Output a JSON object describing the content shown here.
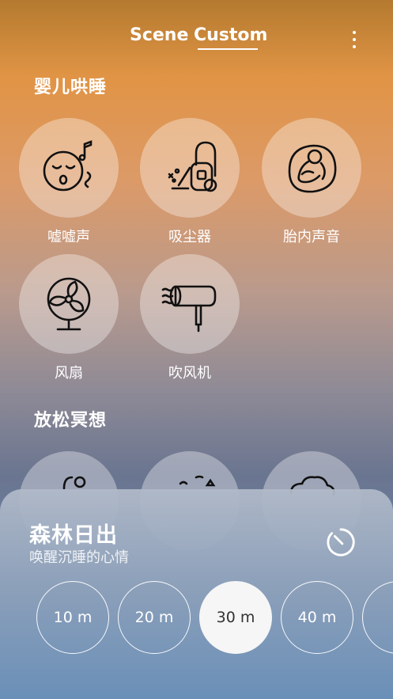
{
  "header": {
    "tabs": [
      {
        "label": "Scene"
      },
      {
        "label": "Custom",
        "selected": true
      }
    ],
    "menu_icon": "more-vertical-icon"
  },
  "sections": [
    {
      "title": "婴儿哄睡",
      "items": [
        {
          "label": "嘘嘘声",
          "icon": "sleeping-face-music-icon"
        },
        {
          "label": "吸尘器",
          "icon": "vacuum-cleaner-icon"
        },
        {
          "label": "胎内声音",
          "icon": "fetus-icon"
        },
        {
          "label": "风扇",
          "icon": "fan-icon"
        },
        {
          "label": "吹风机",
          "icon": "hair-dryer-icon"
        }
      ]
    },
    {
      "title": "放松冥想",
      "items": [
        {
          "label": "",
          "icon": "partial-icon-1"
        },
        {
          "label": "",
          "icon": "partial-icon-2"
        },
        {
          "label": "",
          "icon": "cloud-icon"
        }
      ]
    }
  ],
  "player": {
    "title": "森林日出",
    "subtitle": "唤醒沉睡的心情",
    "timer_icon": "timer-icon",
    "durations": [
      "10 m",
      "20 m",
      "30 m",
      "40 m"
    ],
    "selected_duration": "30 m"
  },
  "colors": {
    "accent_active": "#f6f6f6",
    "tile_bg": "rgba(255,255,255,0.35)"
  }
}
